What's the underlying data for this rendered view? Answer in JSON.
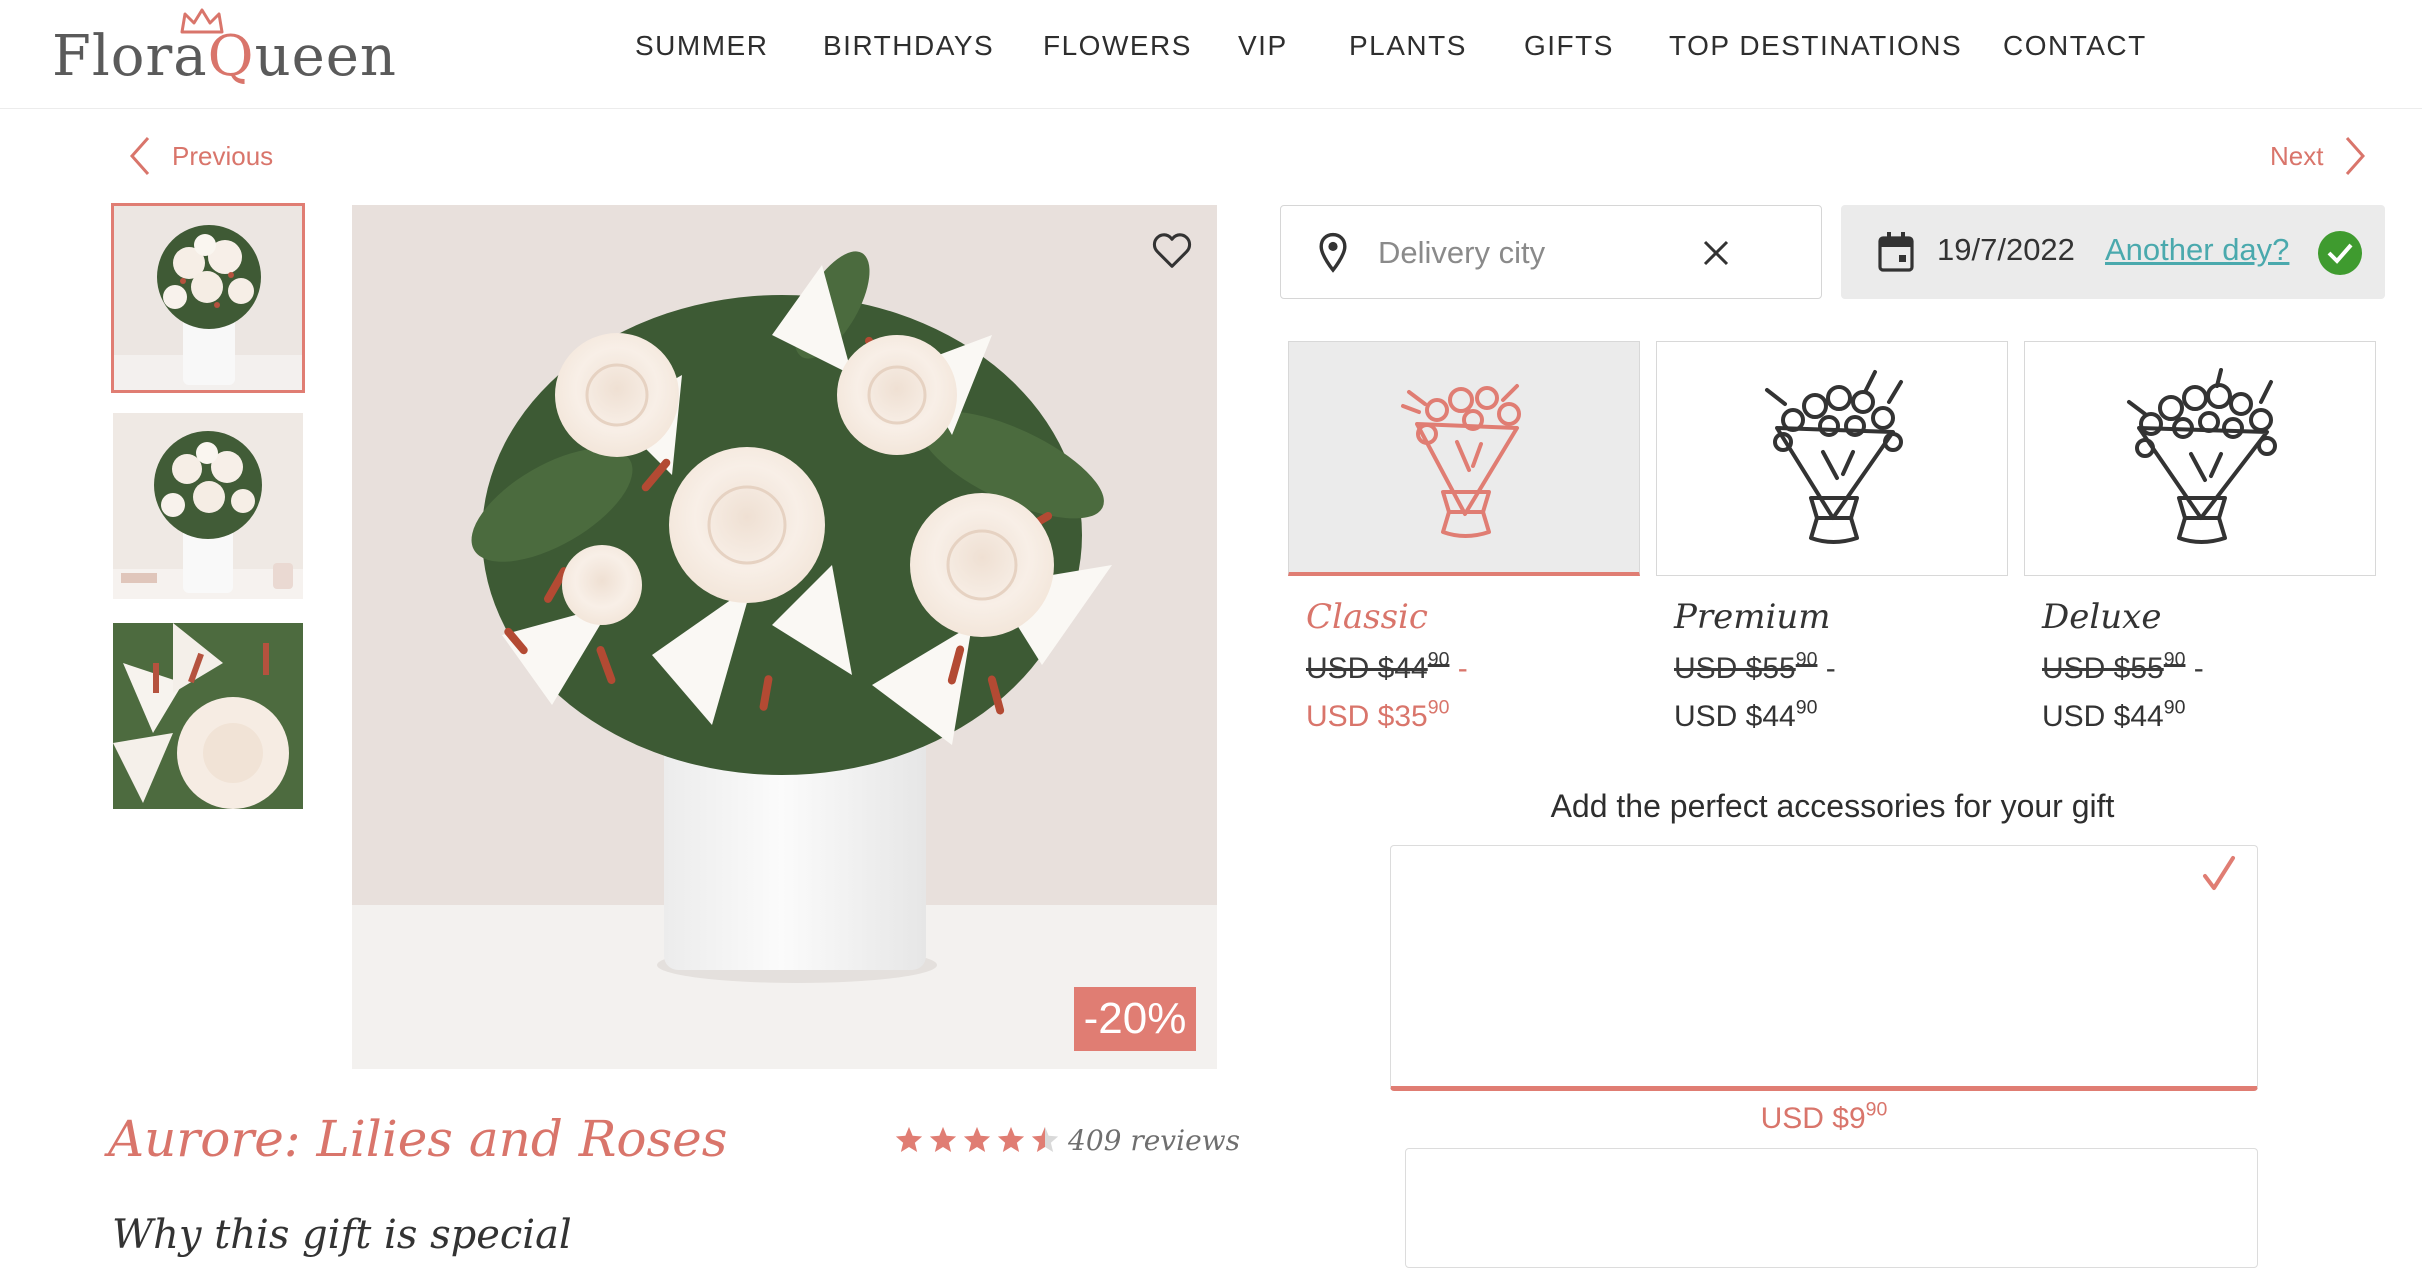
{
  "header": {
    "logo_text_1": "Flora",
    "logo_text_q": "Q",
    "logo_text_2": "ueen",
    "nav": [
      "SUMMER",
      "BIRTHDAYS",
      "FLOWERS",
      "VIP",
      "PLANTS",
      "GIFTS",
      "TOP DESTINATIONS",
      "CONTACT"
    ]
  },
  "pager": {
    "previous": "Previous",
    "next": "Next"
  },
  "product": {
    "title": "Aurore: Lilies and Roses",
    "rating": 4.5,
    "reviews": "409 reviews",
    "discount_badge": "-20%",
    "why_heading": "Why this gift is special"
  },
  "delivery": {
    "city_placeholder": "Delivery city",
    "date": "19/7/2022",
    "another_day": "Another day?"
  },
  "options": [
    {
      "name": "Classic",
      "old_main": "USD $44",
      "old_cents": "90",
      "new_main": "USD $35",
      "new_cents": "90",
      "selected": true
    },
    {
      "name": "Premium",
      "old_main": "USD $55",
      "old_cents": "90",
      "new_main": "USD $44",
      "new_cents": "90",
      "selected": false
    },
    {
      "name": "Deluxe",
      "old_main": "USD $55",
      "old_cents": "90",
      "new_main": "USD $44",
      "new_cents": "90",
      "selected": false
    }
  ],
  "accessories": {
    "title": "Add the perfect accessories for your gift",
    "price_main": "USD $9",
    "price_cents": "90"
  },
  "colors": {
    "accent": "#e07d73",
    "link": "#4aa9ad",
    "check_green": "#3f9b2f",
    "text": "#333333"
  },
  "icons": [
    "crown-icon",
    "chevron-left-icon",
    "chevron-right-icon",
    "heart-icon",
    "location-pin-icon",
    "clear-icon",
    "calendar-icon",
    "check-circle-icon",
    "bouquet-icon",
    "check-icon",
    "star-icon"
  ]
}
